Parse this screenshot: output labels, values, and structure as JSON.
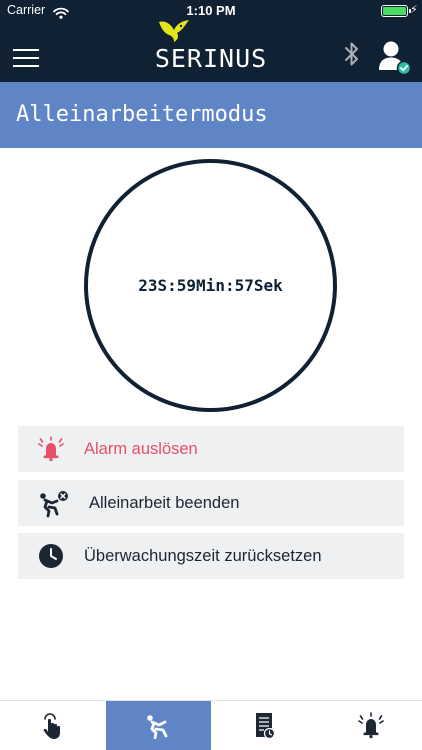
{
  "status_bar": {
    "carrier": "Carrier",
    "time": "1:10 PM",
    "battery_color": "#4cd964",
    "icons": [
      "wifi-icon",
      "battery-icon",
      "charging-bolt-icon"
    ]
  },
  "header": {
    "logo_text": "SERINUS",
    "bg_color": "#0f2132",
    "icons": [
      "hamburger-menu-icon",
      "serinus-bird-icon",
      "bluetooth-icon",
      "user-verified-icon"
    ]
  },
  "page": {
    "title": "Alleinarbeitermodus",
    "title_bg_color": "#5f85c6"
  },
  "timer": {
    "text": "23S:59Min:57Sek"
  },
  "actions": [
    {
      "icon": "alarm-bell-icon",
      "label": "Alarm auslösen",
      "color": "#e84f6b"
    },
    {
      "icon": "fall-person-icon",
      "label": "Alleinarbeit beenden",
      "color": "#1d2733"
    },
    {
      "icon": "clock-icon",
      "label": "Überwachungszeit zurücksetzen",
      "color": "#1d2733"
    }
  ],
  "tabbar": {
    "active_index": 1,
    "active_color": "#5f85c6",
    "tabs": [
      {
        "icon": "touch-hand-icon"
      },
      {
        "icon": "fall-person-icon"
      },
      {
        "icon": "document-clock-icon"
      },
      {
        "icon": "alarm-bell-icon"
      }
    ]
  }
}
